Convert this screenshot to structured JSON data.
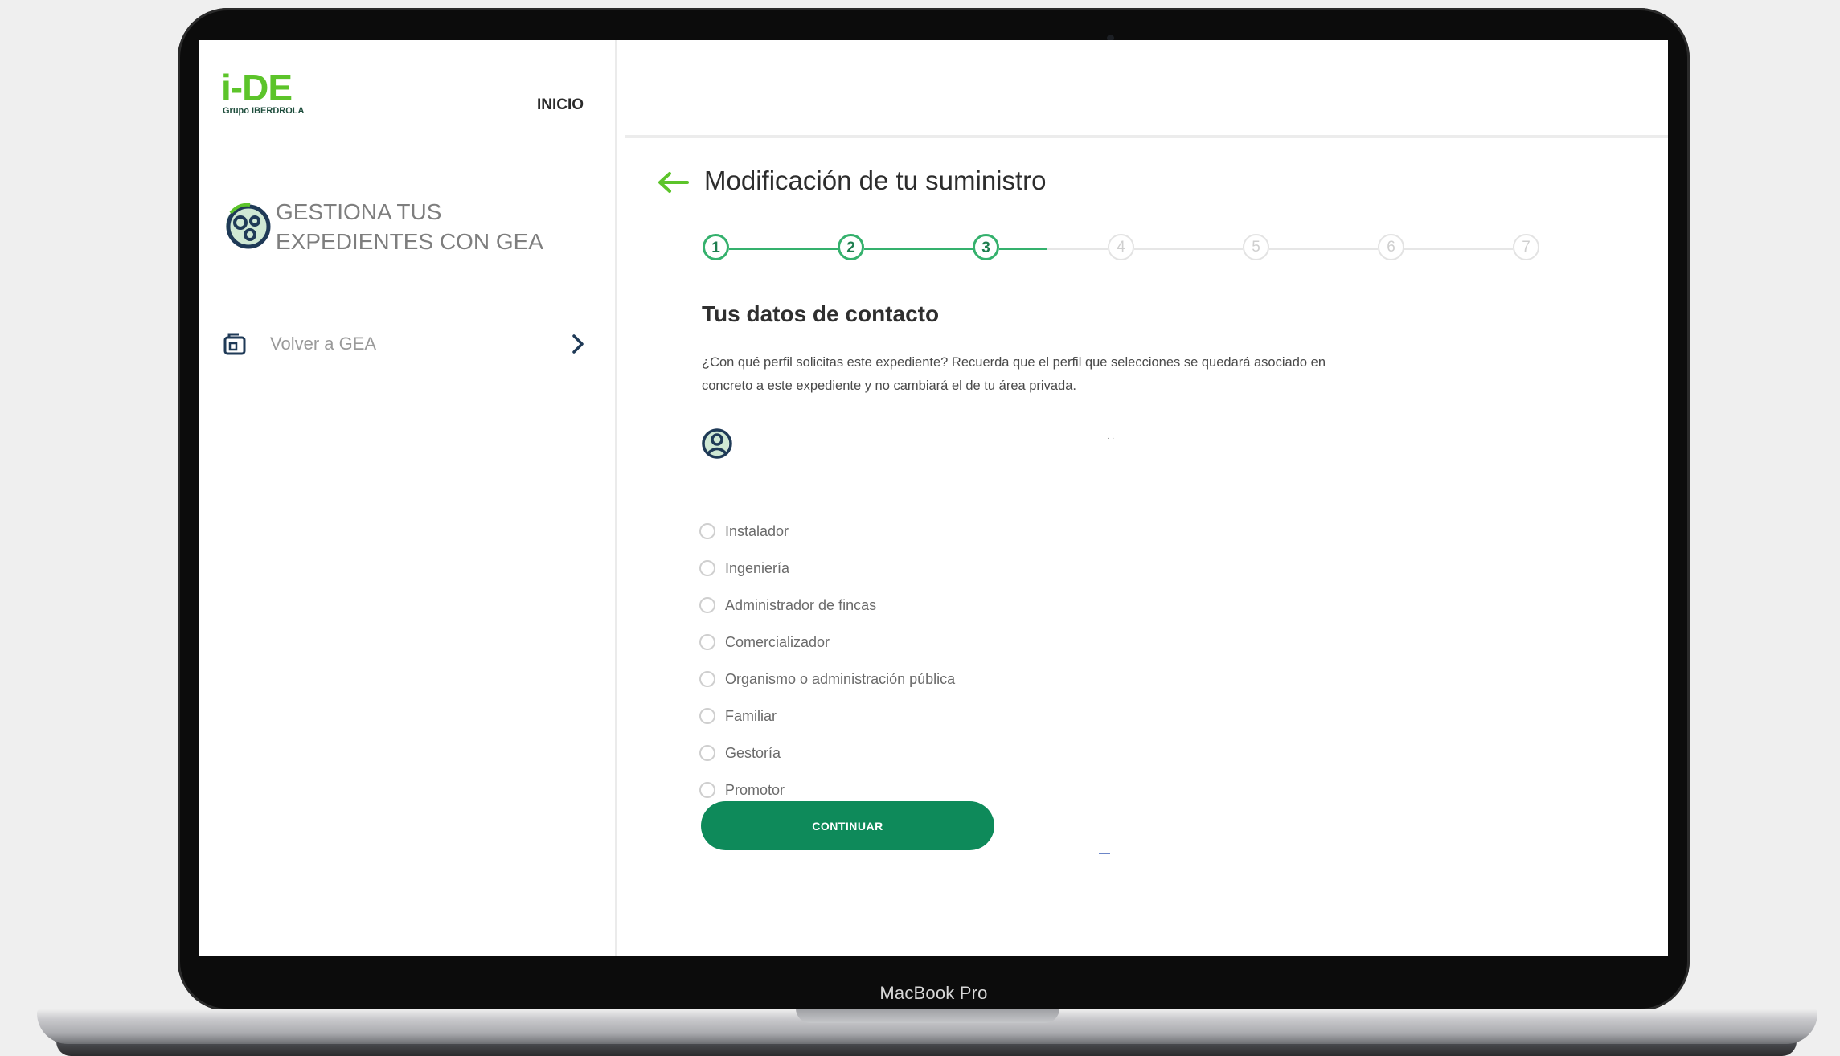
{
  "device": {
    "label": "MacBook Pro"
  },
  "sidebar": {
    "logo": {
      "main": "i-DE",
      "sub": "Grupo IBERDROLA"
    },
    "nav_inicio": "INICIO",
    "gea_title": "GESTIONA TUS EXPEDIENTES CON GEA",
    "volver_label": "Volver a GEA"
  },
  "main": {
    "page_title": "Modificación de tu suministro",
    "stepper": {
      "steps": [
        "1",
        "2",
        "3",
        "4",
        "5",
        "6",
        "7"
      ],
      "current_step": 3
    },
    "section_title": "Tus datos de contacto",
    "section_desc": "¿Con qué perfil solicitas este expediente? Recuerda que el perfil que selecciones se quedará asociado en concreto a este expediente y no cambiará el de tu área privada.",
    "profile_options": [
      "Instalador",
      "Ingeniería",
      "Administrador de fincas",
      "Comercializador",
      "Organismo o administración pública",
      "Familiar",
      "Gestoría",
      "Promotor"
    ],
    "continue_label": "CONTINUAR"
  },
  "colors": {
    "brand_green": "#5cc42a",
    "step_active": "#35b16d",
    "button": "#0e8a5a"
  }
}
